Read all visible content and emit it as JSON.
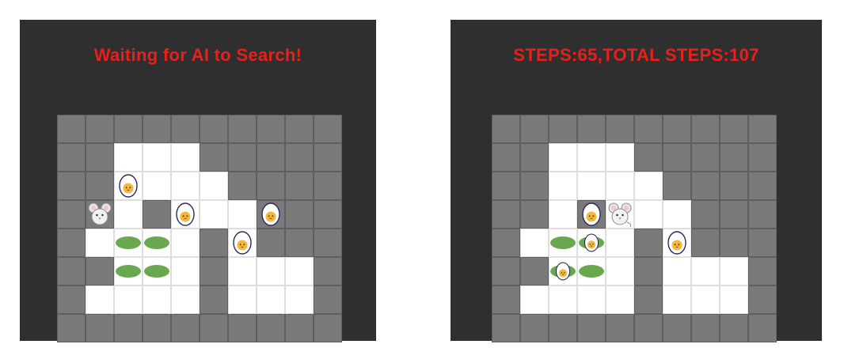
{
  "left_panel": {
    "status_text": "Waiting for AI to Search!",
    "board": {
      "rows": [
        "##########",
        "##   #####",
        "##    ####",
        "## #   ###",
        "#    # ###",
        "##   #   #",
        "#    #   #",
        "##########"
      ]
    }
  },
  "right_panel": {
    "status_text": "STEPS:65,TOTAL STEPS:107",
    "board": {
      "rows": [
        "##########",
        "##   #####",
        "##    ####",
        "## #   ###",
        "#    # ###",
        "##   #   #",
        "#    #   #",
        "##########"
      ]
    }
  },
  "colors": {
    "background": "#2f2f2f",
    "wall": "#7a7a7a",
    "floor": "#ffffff",
    "target": "#6aa84f",
    "status_text": "#e8201c"
  }
}
